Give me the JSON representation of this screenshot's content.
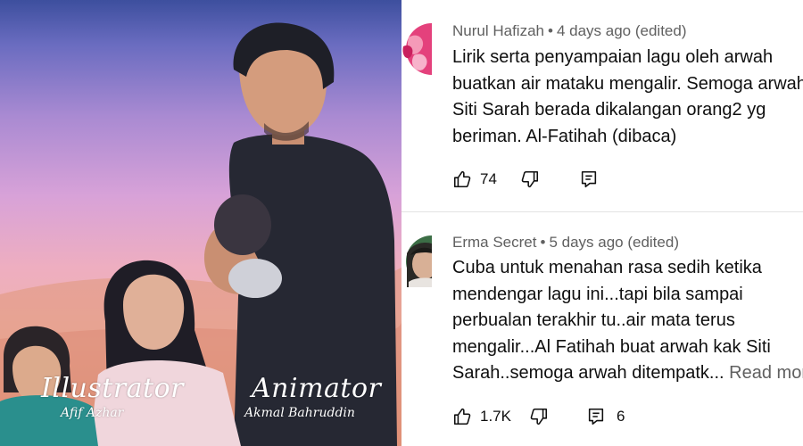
{
  "video": {
    "credits": [
      {
        "role": "Illustrator",
        "name": "Afif Azhar"
      },
      {
        "role": "Animator",
        "name": "Akmal Bahruddin"
      }
    ]
  },
  "comments": [
    {
      "author": "Nurul Hafizah",
      "time": "4 days ago (edited)",
      "lines": [
        "Lirik serta penyampaian lagu oleh arwah",
        "buatkan air mataku mengalir. Semoga arwah",
        "Siti Sarah berada dikalangan orang2 yg",
        "beriman. Al-Fatihah (dibaca)"
      ],
      "read_more": "",
      "likes": "74",
      "replies": "",
      "avatar_icon": "avatar-pink-flower",
      "avatar_color": "#e4417c"
    },
    {
      "author": "Erma Secret",
      "time": "5 days ago (edited)",
      "lines": [
        "Cuba untuk menahan rasa sedih ketika",
        "mendengar lagu ini...tapi bila sampai",
        "perbualan terakhir tu..air mata terus",
        "mengalir...Al Fatihah buat arwah kak Siti",
        "Sarah..semoga arwah ditempatk..."
      ],
      "read_more": "Read more",
      "likes": "1.7K",
      "replies": "6",
      "avatar_icon": "avatar-portrait",
      "avatar_color": "#3c6e46"
    }
  ],
  "icons": {
    "like": "thumb-up-icon",
    "dislike": "thumb-down-icon",
    "reply": "reply-comment-icon"
  },
  "colors": {
    "meta_text": "#606060",
    "body_text": "#0f0f0f",
    "divider": "#e3e3e3"
  }
}
